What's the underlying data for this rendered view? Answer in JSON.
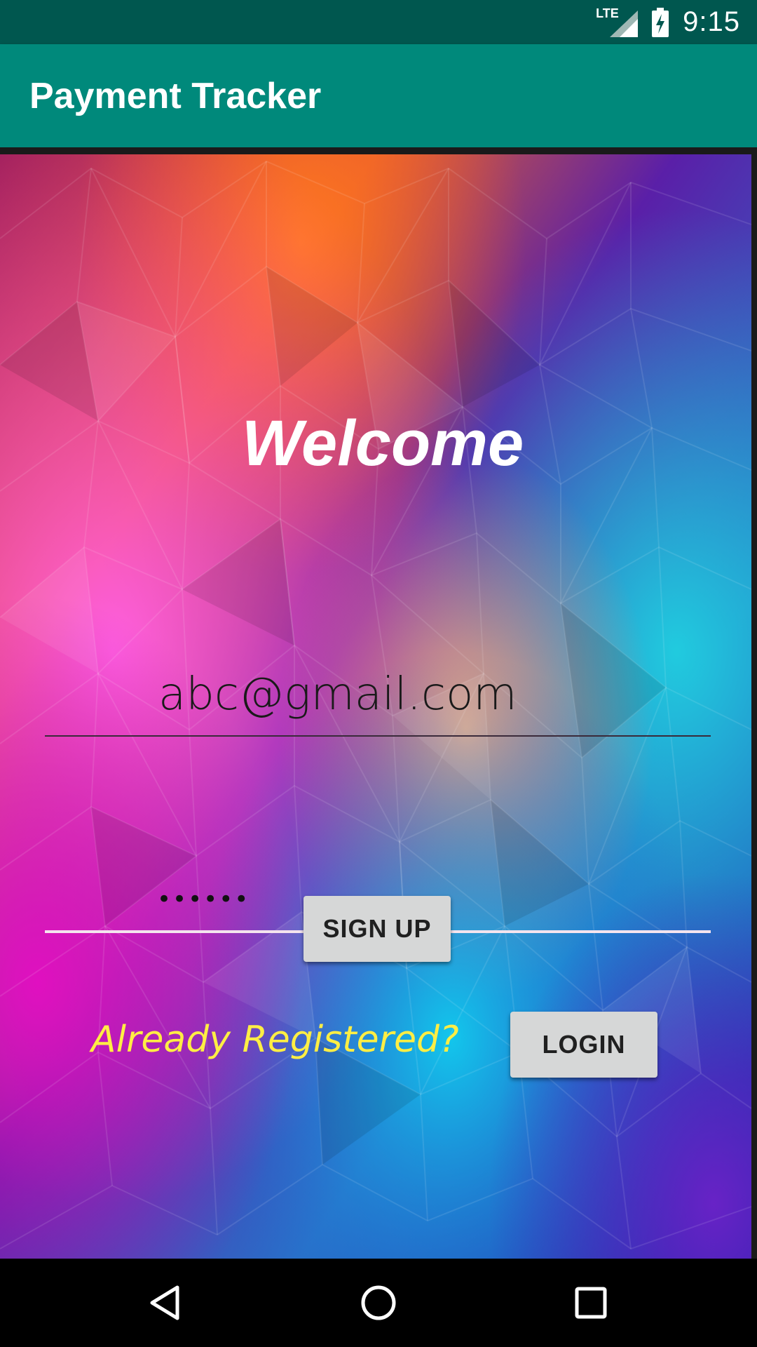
{
  "status_bar": {
    "network": "LTE",
    "time": "9:15",
    "icons": [
      "lte-signal-icon",
      "battery-charging-icon"
    ]
  },
  "app_bar": {
    "title": "Payment Tracker",
    "color": "#00897b"
  },
  "main": {
    "welcome": "Welcome",
    "email": {
      "value": "abc@gmail.com",
      "placeholder": ""
    },
    "password": {
      "value": "••••••",
      "placeholder": ""
    },
    "signup_label": "SIGN UP",
    "already_registered": "Already Registered?",
    "login_label": "LOGIN"
  },
  "nav_bar": {
    "icons": [
      "back-icon",
      "home-icon",
      "recents-icon"
    ]
  },
  "colors": {
    "status_bar": "#00574f",
    "accent_text": "#ffee44",
    "button_bg": "#d6d7d7"
  }
}
